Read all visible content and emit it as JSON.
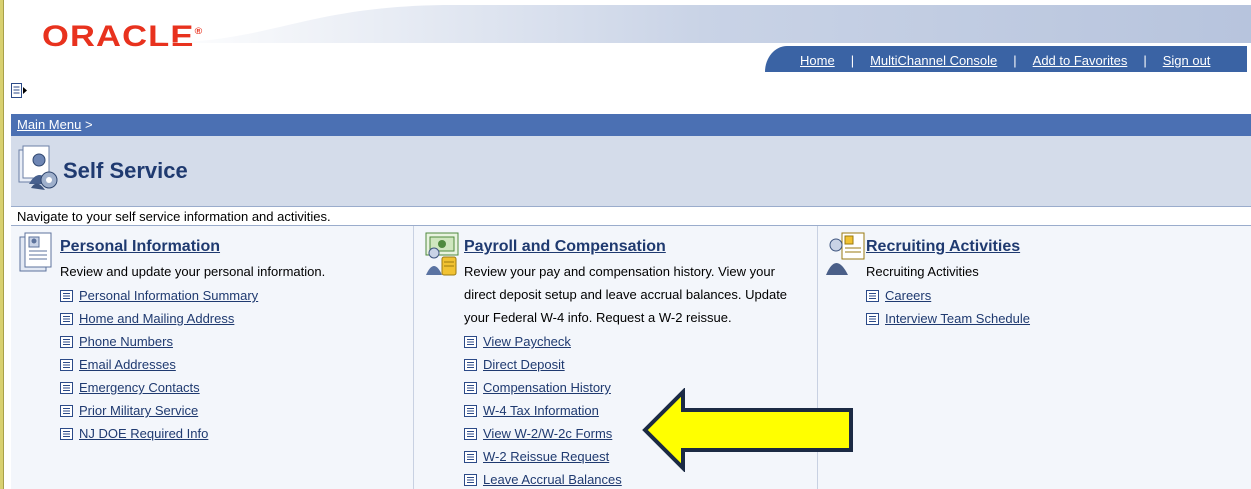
{
  "brand": {
    "logo": "ORACLE",
    "registered": "®"
  },
  "header_nav": [
    {
      "label": "Home"
    },
    {
      "label": "MultiChannel Console"
    },
    {
      "label": "Add to Favorites"
    },
    {
      "label": "Sign out"
    }
  ],
  "breadcrumb": {
    "label": "Main Menu",
    "separator": ">"
  },
  "page": {
    "title": "Self Service",
    "subtitle": "Navigate to your self service information and activities."
  },
  "categories": [
    {
      "title": "Personal Information",
      "description": "Review and update your personal information.",
      "links": [
        "Personal Information Summary",
        "Home and Mailing Address",
        "Phone Numbers",
        "Email Addresses",
        "Emergency Contacts",
        "Prior Military Service",
        "NJ DOE Required Info"
      ]
    },
    {
      "title": "Payroll and Compensation",
      "description_lines": [
        "Review your pay and compensation history. View your",
        "direct deposit setup and leave accrual balances. Update",
        "your Federal W-4 info. Request a W-2 reissue."
      ],
      "links": [
        "View Paycheck",
        "Direct Deposit",
        "Compensation History",
        "W-4 Tax Information",
        "View W-2/W-2c Forms",
        "W-2 Reissue Request",
        "Leave Accrual Balances"
      ]
    },
    {
      "title": "Recruiting Activities",
      "description": "Recruiting Activities",
      "links": [
        "Careers",
        "Interview Team Schedule"
      ]
    }
  ],
  "colors": {
    "brand_red": "#e8321e",
    "nav_blue": "#3a63a4",
    "link_blue": "#1f3a70",
    "arrow_fill": "#ffff00"
  }
}
